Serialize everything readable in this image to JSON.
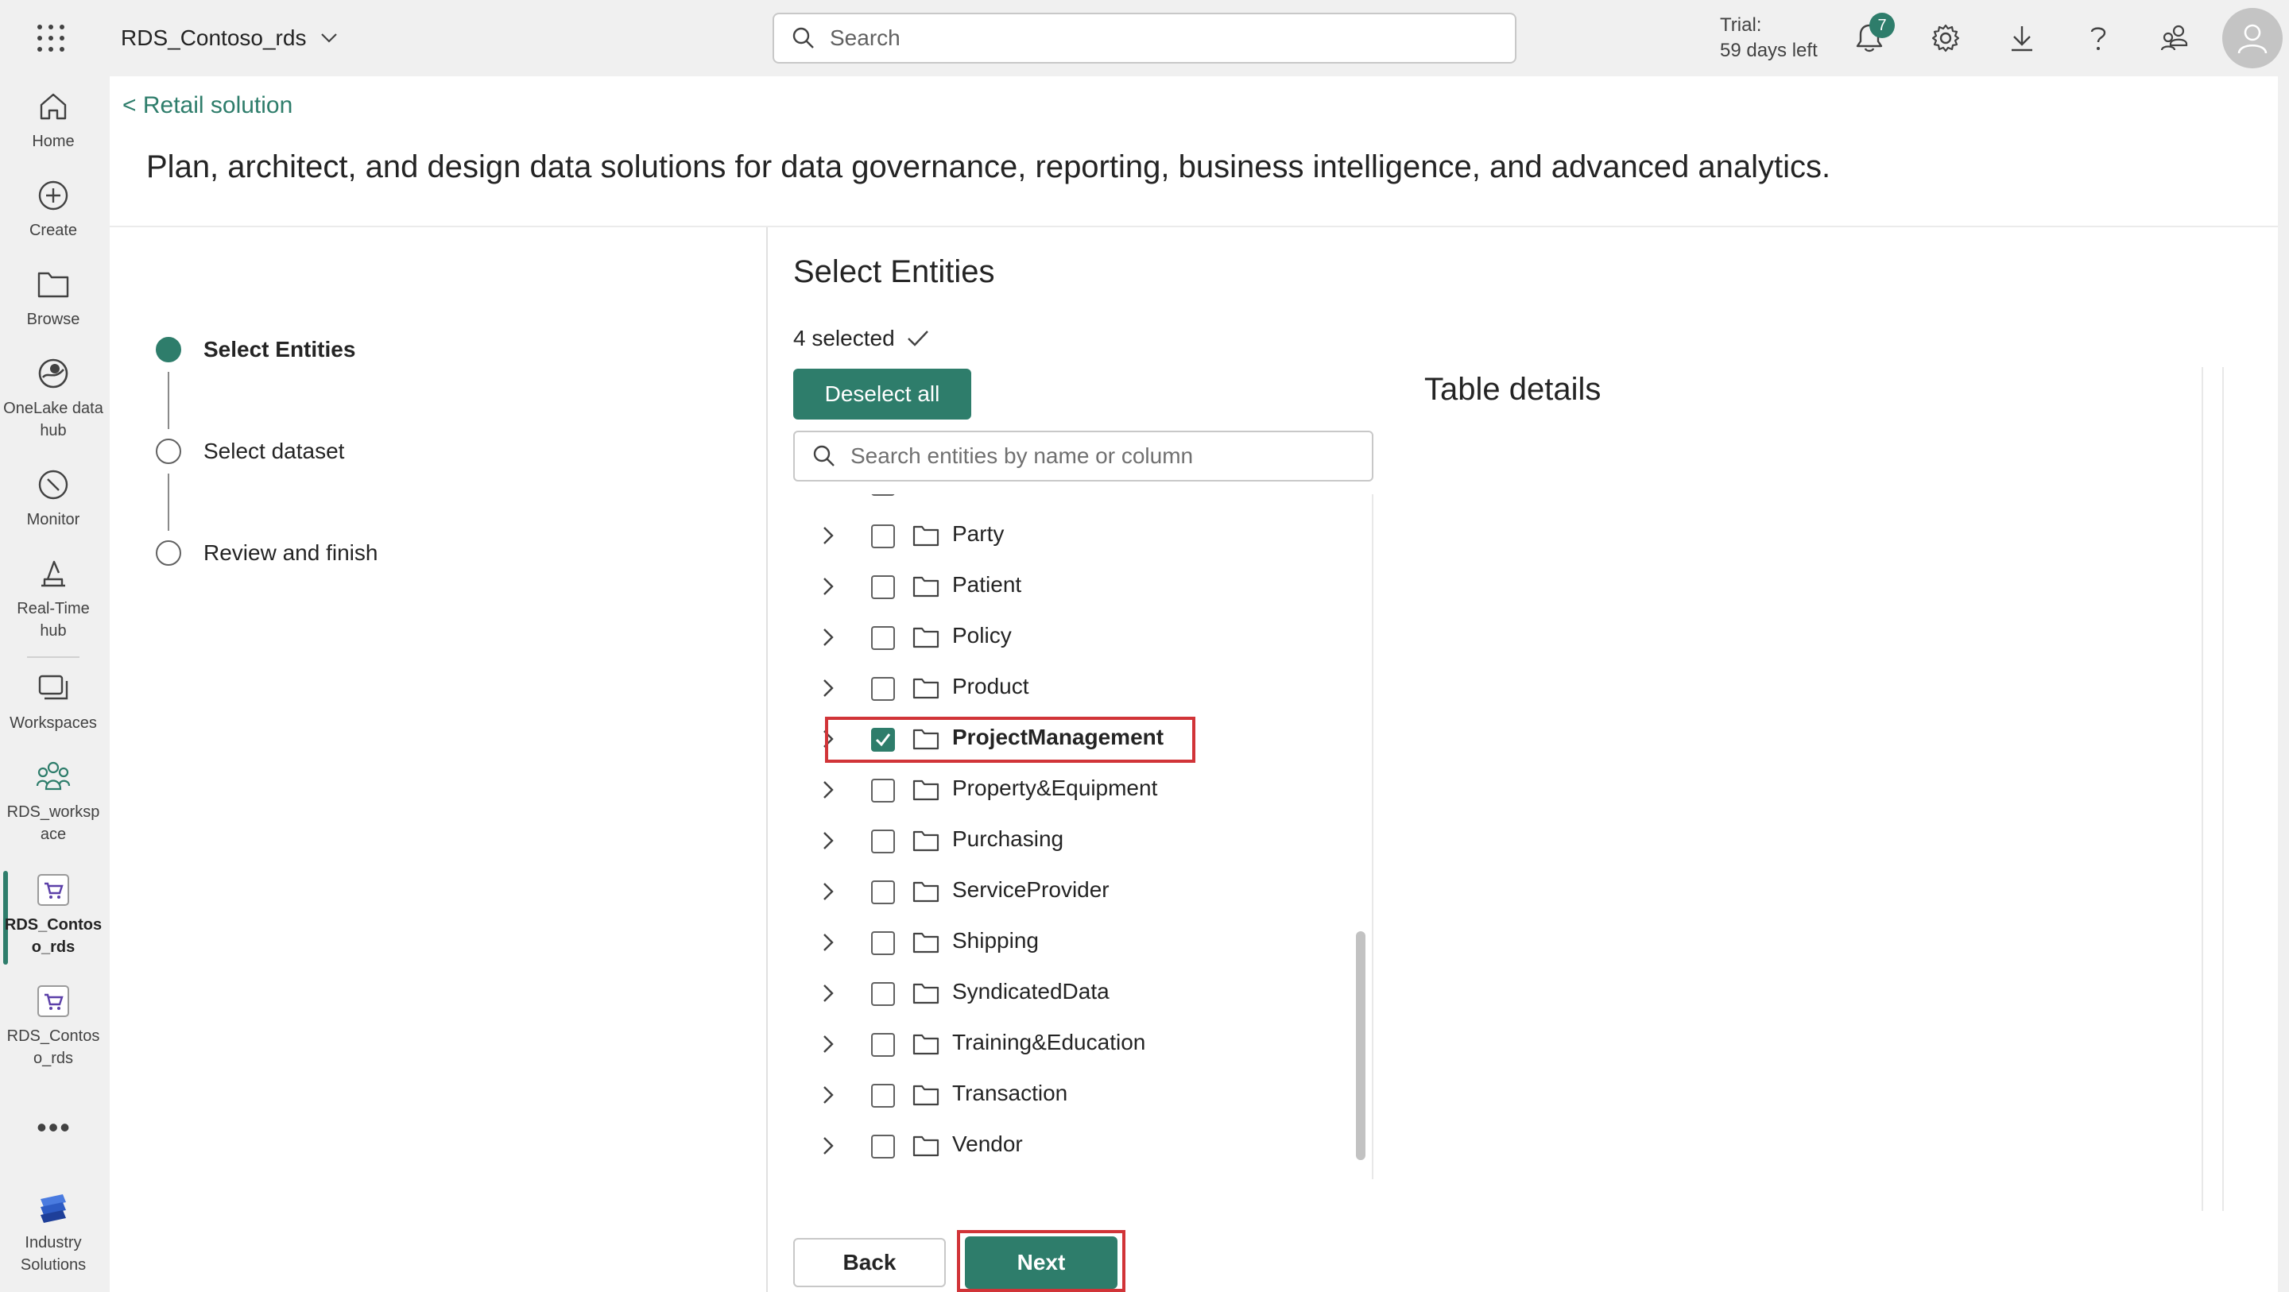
{
  "topbar": {
    "workspace_name": "RDS_Contoso_rds",
    "search_placeholder": "Search",
    "trial_line1": "Trial:",
    "trial_line2": "59 days left",
    "notification_count": "7"
  },
  "rail": {
    "items": [
      {
        "label": "Home",
        "icon": "home-icon"
      },
      {
        "label": "Create",
        "icon": "create-icon"
      },
      {
        "label": "Browse",
        "icon": "folder-icon"
      },
      {
        "label": "OneLake data hub",
        "icon": "onelake-icon"
      },
      {
        "label": "Monitor",
        "icon": "monitor-icon"
      },
      {
        "label": "Real-Time hub",
        "icon": "realtime-icon"
      },
      {
        "label": "Workspaces",
        "icon": "workspaces-icon"
      },
      {
        "label": "RDS_worksp ace",
        "icon": "people-icon"
      },
      {
        "label": "RDS_Contos o_rds",
        "icon": "cart-icon"
      },
      {
        "label": "RDS_Contos o_rds",
        "icon": "cart-icon"
      },
      {
        "label": "Industry Solutions",
        "icon": "industry-icon"
      }
    ],
    "more": "•••"
  },
  "main": {
    "back_link": "< Retail solution",
    "headline": "Plan, architect, and design data solutions for data governance, reporting, business intelligence, and advanced analytics.",
    "steps": [
      {
        "label": "Select Entities",
        "state": "current"
      },
      {
        "label": "Select dataset",
        "state": "pending"
      },
      {
        "label": "Review and finish",
        "state": "pending"
      }
    ],
    "section_title": "Select Entities",
    "selected_count": "4 selected",
    "deselect_all": "Deselect all",
    "entity_search_placeholder": "Search entities by name or column",
    "entities": [
      {
        "name": "Party",
        "checked": false
      },
      {
        "name": "Patient",
        "checked": false
      },
      {
        "name": "Policy",
        "checked": false
      },
      {
        "name": "Product",
        "checked": false
      },
      {
        "name": "ProjectManagement",
        "checked": true
      },
      {
        "name": "Property&Equipment",
        "checked": false
      },
      {
        "name": "Purchasing",
        "checked": false
      },
      {
        "name": "ServiceProvider",
        "checked": false
      },
      {
        "name": "Shipping",
        "checked": false
      },
      {
        "name": "SyndicatedData",
        "checked": false
      },
      {
        "name": "Training&Education",
        "checked": false
      },
      {
        "name": "Transaction",
        "checked": false
      },
      {
        "name": "Vendor",
        "checked": false
      }
    ],
    "table_details_title": "Table details",
    "back_button": "Back",
    "next_button": "Next"
  },
  "colors": {
    "accent": "#2e7d6b",
    "highlight": "#d13438"
  }
}
